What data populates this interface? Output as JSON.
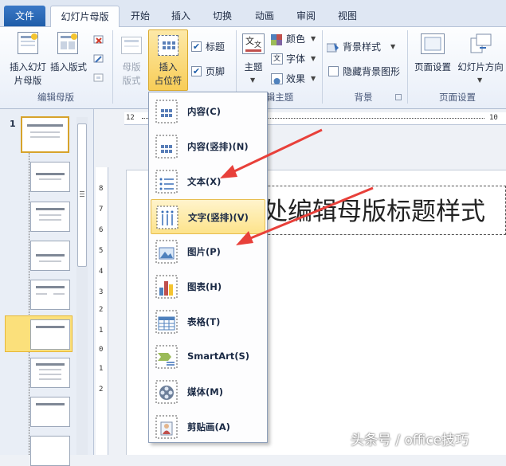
{
  "tabs": [
    {
      "label": "文件"
    },
    {
      "label": "幻灯片母版"
    },
    {
      "label": "开始"
    },
    {
      "label": "插入"
    },
    {
      "label": "切换"
    },
    {
      "label": "动画"
    },
    {
      "label": "审阅"
    },
    {
      "label": "视图"
    }
  ],
  "ribbon": {
    "insert_slide_master": "插入幻灯片母版",
    "insert_slide_master_l1": "插入幻灯",
    "insert_slide_master_l2": "片母版",
    "insert_layout": "插入版式",
    "edit_master_group": "编辑母版",
    "master_layout_l1": "母版",
    "master_layout_l2": "版式",
    "insert_placeholder_l1": "插入",
    "insert_placeholder_l2": "占位符",
    "title_checkbox": "标题",
    "footer_checkbox": "页脚",
    "theme": "主题",
    "colors": "颜色",
    "fonts": "字体",
    "effects": "效果",
    "edit_theme_group": "编辑主题",
    "edit_theme_group_visible": "辑主题",
    "background_styles": "背景样式",
    "hide_background": "隐藏背景图形",
    "background_group": "背景",
    "page_setup": "页面设置",
    "slide_orientation": "幻灯片方向",
    "page_setup_group": "页面设置"
  },
  "thumbnails": {
    "first_number": "1"
  },
  "rulers": {
    "h_labels": [
      "12",
      "10"
    ],
    "v_labels": [
      "8",
      "7",
      "6",
      "5",
      "4",
      "3",
      "2",
      "1",
      "0",
      "1",
      "2"
    ]
  },
  "slide": {
    "title_visible": "处编辑母版标题样式"
  },
  "menu": {
    "items": [
      {
        "label": "内容(C)",
        "icon": "content-placeholder-icon"
      },
      {
        "label": "内容(竖排)(N)",
        "icon": "vertical-content-placeholder-icon"
      },
      {
        "label": "文本(X)",
        "icon": "text-placeholder-icon"
      },
      {
        "label": "文字(竖排)(V)",
        "icon": "vertical-text-placeholder-icon"
      },
      {
        "label": "图片(P)",
        "icon": "picture-placeholder-icon"
      },
      {
        "label": "图表(H)",
        "icon": "chart-placeholder-icon"
      },
      {
        "label": "表格(T)",
        "icon": "table-placeholder-icon"
      },
      {
        "label": "SmartArt(S)",
        "icon": "smartart-placeholder-icon"
      },
      {
        "label": "媒体(M)",
        "icon": "media-placeholder-icon"
      },
      {
        "label": "剪贴画(A)",
        "icon": "clipart-placeholder-icon"
      }
    ],
    "highlighted_index": 3
  },
  "annotation_color": "#e8403a",
  "watermark": "头条号 / office技巧"
}
